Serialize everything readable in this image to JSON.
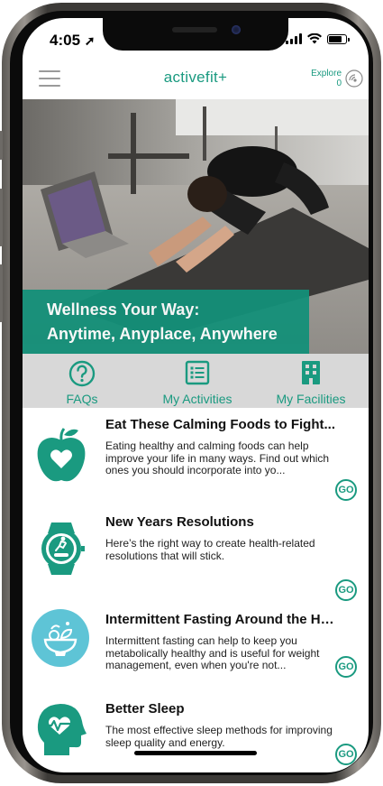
{
  "status": {
    "time": "4:05"
  },
  "app": {
    "logo": "activefit+",
    "explore_label": "Explore",
    "explore_count": "0"
  },
  "hero": {
    "line1": "Wellness Your Way:",
    "line2": "Anytime, Anyplace, Anywhere"
  },
  "tabs": [
    {
      "label": "FAQs",
      "icon": "question-circle-icon"
    },
    {
      "label": "My Activities",
      "icon": "list-icon"
    },
    {
      "label": "My Facilities",
      "icon": "building-icon"
    }
  ],
  "articles": [
    {
      "title": "Eat These Calming Foods to Fight...",
      "desc": "Eating healthy and calming foods can help improve your life in many ways. Find out which ones you should incorporate into yo...",
      "icon": "apple-heart-icon",
      "go": "GO"
    },
    {
      "title": "New Years Resolutions",
      "desc": "Here’s the right way to create health-related resolutions that will stick.",
      "icon": "fitness-watch-icon",
      "go": "GO"
    },
    {
      "title": "Intermittent Fasting Around the Ho...",
      "desc": "Intermittent fasting can help to keep you metabolically healthy and is useful for weight management, even when you're not...",
      "icon": "food-bowl-icon",
      "go": "GO"
    },
    {
      "title": "Better Sleep",
      "desc": "The most effective sleep methods for improving sleep quality and energy.",
      "icon": "head-heartbeat-icon",
      "go": "GO"
    }
  ],
  "colors": {
    "accent": "#1a9a80",
    "tab_bar": "#d8d8d8",
    "banner": "#149079",
    "bowl_circle": "#5ec4d6"
  }
}
